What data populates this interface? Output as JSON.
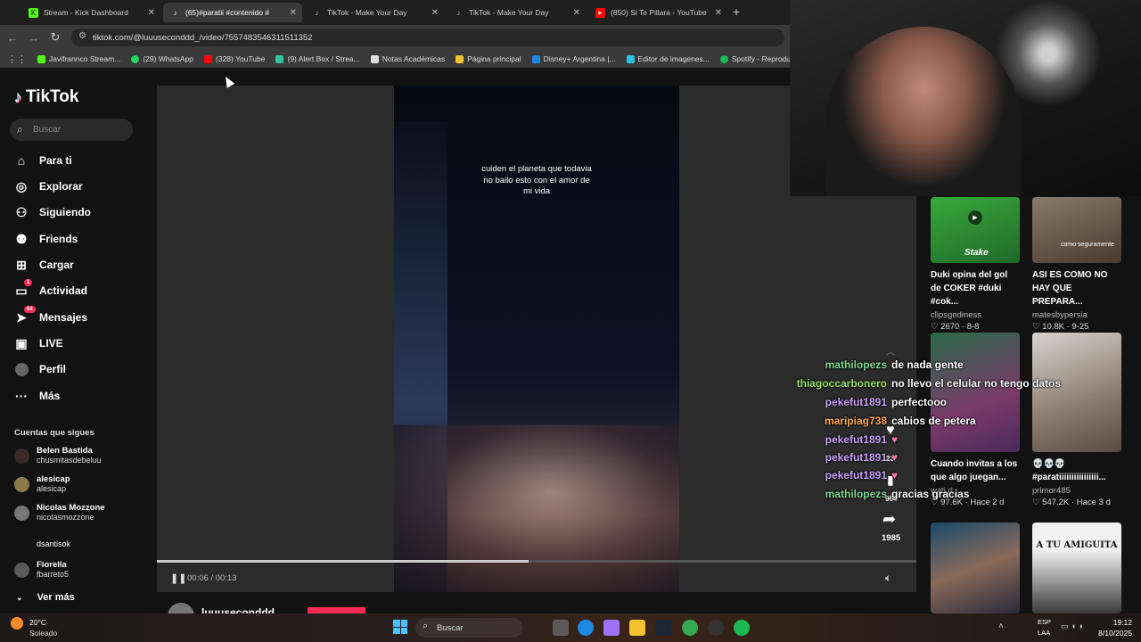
{
  "tabs": [
    {
      "label": "Stream - Kick Dashboard",
      "favicon": "kick-icon",
      "color": "#53fc18"
    },
    {
      "label": "(65)#paratii #contenido #",
      "favicon": "tiktok-icon",
      "color": "#ffffff",
      "active": true
    },
    {
      "label": "TikTok - Make Your Day",
      "favicon": "tiktok-icon",
      "color": "#ffffff"
    },
    {
      "label": "TikTok - Make Your Day",
      "favicon": "tiktok-icon",
      "color": "#ffffff"
    },
    {
      "label": "(850) Si Te Pillara - YouTube",
      "favicon": "youtube-icon",
      "color": "#ff0000"
    }
  ],
  "url": "tiktok.com/@luuuseconddd_/video/7557483546311511352",
  "bookmarks": [
    {
      "label": "Javifrannco Stream...",
      "color": "#53fc18"
    },
    {
      "label": "(29) WhatsApp",
      "color": "#25d366"
    },
    {
      "label": "(328) YouTube",
      "color": "#ff0000"
    },
    {
      "label": "(9) Alert Box / Strea...",
      "color": "#31c3a2"
    },
    {
      "label": "Notas Académicas",
      "color": "#e0e0e0"
    },
    {
      "label": "Página principal",
      "color": "#f4c430"
    },
    {
      "label": "Disney+ Argentina |...",
      "color": "#1e88e5"
    },
    {
      "label": "Editor de imagenes...",
      "color": "#26c6da"
    },
    {
      "label": "Spotify - Reproduct...",
      "color": "#1db954"
    }
  ],
  "tiktok": {
    "logo": "TikTok",
    "search_placeholder": "Buscar",
    "nav": [
      {
        "label": "Para ti",
        "icon": "home-icon"
      },
      {
        "label": "Explorar",
        "icon": "compass-icon"
      },
      {
        "label": "Siguiendo",
        "icon": "following-icon"
      },
      {
        "label": "Friends",
        "icon": "friends-icon"
      },
      {
        "label": "Cargar",
        "icon": "upload-icon"
      },
      {
        "label": "Actividad",
        "icon": "activity-icon",
        "badge": "1"
      },
      {
        "label": "Mensajes",
        "icon": "messages-icon",
        "badge": "64"
      },
      {
        "label": "LIVE",
        "icon": "live-icon"
      },
      {
        "label": "Perfil",
        "icon": "profile-icon"
      },
      {
        "label": "Más",
        "icon": "more-icon"
      }
    ],
    "following_title": "Cuentas que sigues",
    "following": [
      {
        "name": "Belen Bastida",
        "handle": "chusmitasdebeluu"
      },
      {
        "name": "alesicap",
        "handle": "alesicap"
      },
      {
        "name": "Nicolas Mozzone",
        "handle": "nicolasmozzone"
      },
      {
        "name": "",
        "handle": "dsantisok"
      },
      {
        "name": "Fiorella",
        "handle": "fbarreto5"
      }
    ],
    "see_more": "Ver más",
    "caption": "cuiden el planeta que todavia no bailo esto con el amor de mi vida",
    "time": "00:06 / 00:13",
    "progress": 0.49,
    "author": "luuuseconddd",
    "share_count": "1985",
    "comment_count": "23",
    "save_count": "964"
  },
  "chat": [
    {
      "user": "mathilopezs",
      "message": "de nada gente",
      "color": "#7bd88f"
    },
    {
      "user": "thiagoccarbonero",
      "message": "no llevo el celular no tengo datos",
      "color": "#9be564"
    },
    {
      "user": "pekefut1891",
      "message": "perfectooo",
      "color": "#c9a0ff"
    },
    {
      "user": "maripiag738",
      "message": "cabios de petera",
      "color": "#ffa64d"
    },
    {
      "user": "pekefut1891",
      "message": "",
      "color": "#c9a0ff"
    },
    {
      "user": "pekefut1891",
      "message": "",
      "color": "#c9a0ff"
    },
    {
      "user": "pekefut1891",
      "message": "",
      "color": "#c9a0ff"
    },
    {
      "user": "mathilopezs",
      "message": "gracias gracias",
      "color": "#7bd88f"
    }
  ],
  "cards": [
    {
      "title": "Duki opina del gol de COKER #duki #cok...",
      "user": "clipsgodiness",
      "stats": "♡ 2670 · 8-8",
      "thumb_text": "Stake"
    },
    {
      "title": "ASI ES COMO NO HAY QUE PREPARA...",
      "user": "matesbypersia",
      "stats": "♡ 10.8K · 9-25",
      "thumb_text": "como seguramente"
    },
    {
      "title": "Cuando invitas a los que algo juegan...",
      "user": "wati.rl",
      "stats": "♡ 97.6K · Hace 2 d",
      "thumb_text": ""
    },
    {
      "title": "💀💀💀 #paratiiiiiiiiiiiiiiii...",
      "user": "primor485",
      "stats": "♡ 547.2K · Hace 3 d",
      "thumb_text": ""
    },
    {
      "title": "",
      "user": "",
      "stats": "",
      "thumb_text": ""
    },
    {
      "title": "",
      "user": "",
      "stats": "",
      "thumb_text": "A TU AMIGUITA"
    }
  ],
  "taskbar": {
    "weather_temp": "20°C",
    "weather_desc": "Soleado",
    "search": "Buscar",
    "lang": "ESP",
    "lang2": "LAA",
    "time": "19:12",
    "date": "8/10/2025"
  }
}
